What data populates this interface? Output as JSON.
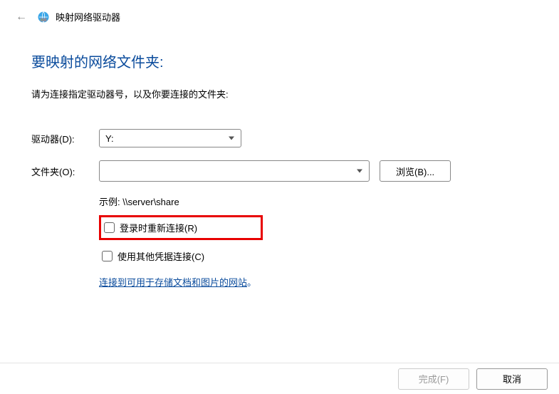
{
  "header": {
    "back_icon": "←",
    "window_title": "映射网络驱动器"
  },
  "heading": "要映射的网络文件夹:",
  "instruction": "请为连接指定驱动器号，以及你要连接的文件夹:",
  "drive": {
    "label": "驱动器(D):",
    "value": "Y:"
  },
  "folder": {
    "label": "文件夹(O):",
    "value": "",
    "browse": "浏览(B)...",
    "example": "示例: \\\\server\\share"
  },
  "options": {
    "reconnect": "登录时重新连接(R)",
    "other_credentials": "使用其他凭据连接(C)",
    "link_text": "连接到可用于存储文档和图片的网站",
    "link_period": "。"
  },
  "footer": {
    "finish": "完成(F)",
    "cancel": "取消"
  }
}
